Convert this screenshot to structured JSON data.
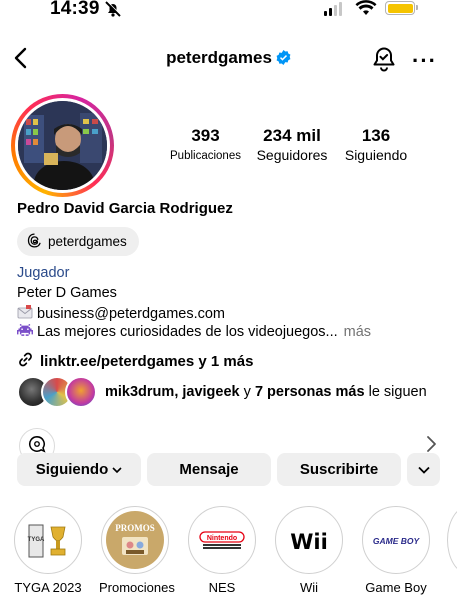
{
  "status_bar": {
    "time": "14:39"
  },
  "header": {
    "username": "peterdgames",
    "more_label": "···"
  },
  "profile": {
    "stats": [
      {
        "value": "393",
        "label": "Publicaciones"
      },
      {
        "value": "234 mil",
        "label": "Seguidores"
      },
      {
        "value": "136",
        "label": "Siguiendo"
      }
    ],
    "full_name": "Pedro David Garcia Rodriguez",
    "threads_handle": "peterdgames",
    "category": "Jugador",
    "bio_line1": "Peter D Games",
    "bio_line2": "business@peterdgames.com",
    "bio_line3": "Las mejores curiosidades de los videojuegos...",
    "bio_more": "más",
    "link": "linktr.ee/peterdgames y 1 más",
    "followed_by": {
      "user1": "mik3drum",
      "user2": "javigeek",
      "connector": "y",
      "others": "7 personas más",
      "suffix": "le siguen"
    }
  },
  "actions": {
    "following": "Siguiendo",
    "message": "Mensaje",
    "subscribe": "Suscribirte"
  },
  "highlights": [
    {
      "label": "TYGA 2023",
      "art": "TYGA"
    },
    {
      "label": "Promociones",
      "art": "PROMOS"
    },
    {
      "label": "NES",
      "art": "Nintendo"
    },
    {
      "label": "Wii",
      "art": "Wii"
    },
    {
      "label": "Game Boy",
      "art": "GAME BOY"
    }
  ],
  "colors": {
    "accent": "#0095f6",
    "category": "#2a4a8a",
    "button_bg": "#efefef",
    "battery": "#f5c400"
  }
}
